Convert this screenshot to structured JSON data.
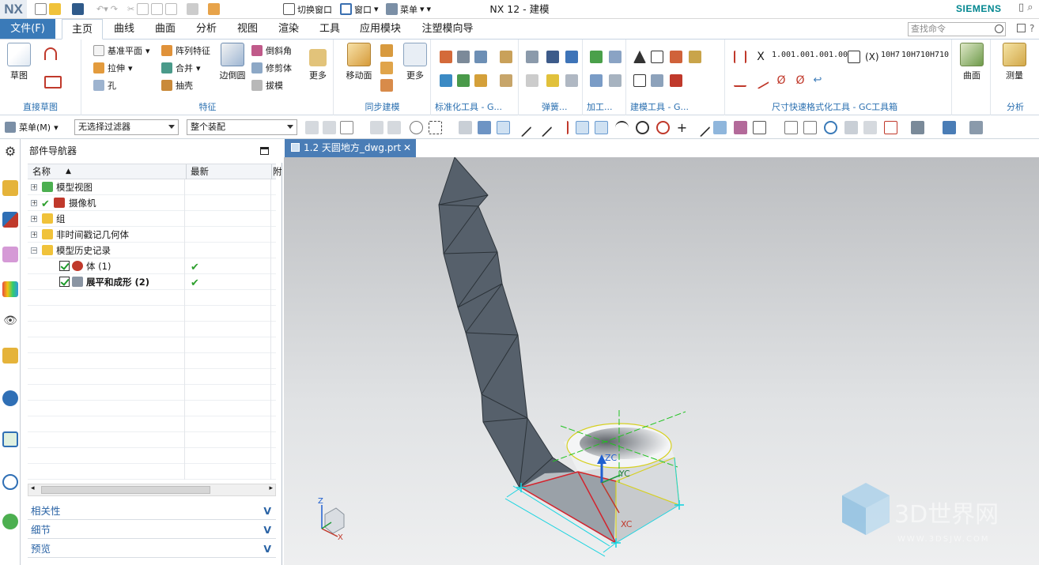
{
  "window": {
    "title": "NX 12 - 建模",
    "logo": "NX",
    "brand": "SIEMENS",
    "quick_access": {
      "switch_window": "切换窗口",
      "window_menu": "窗口",
      "menu": "菜单"
    }
  },
  "tabs": {
    "file": "文件(F)",
    "items": [
      "主页",
      "曲线",
      "曲面",
      "分析",
      "视图",
      "渲染",
      "工具",
      "应用模块",
      "注塑模向导"
    ],
    "search_placeholder": "查找命令"
  },
  "ribbon": {
    "direct_sketch": {
      "label": "直接草图",
      "sketch": "草图"
    },
    "feature": {
      "label": "特征",
      "datum_plane": "基准平面",
      "extrude": "拉伸",
      "hole": "孔",
      "pattern_feature": "阵列特征",
      "unite": "合并",
      "shell": "抽壳",
      "edge_blend": "边倒圆",
      "chamfer": "倒斜角",
      "trim_body": "修剪体",
      "draft": "拔模",
      "more": "更多"
    },
    "sync_modeling": {
      "label": "同步建模",
      "move_face": "移动面",
      "more": "更多"
    },
    "group_labels": [
      "标准化工具 - G...",
      "弹簧...",
      "加工...",
      "建模工具 - G...",
      "尺寸快速格式化工具 - GC工具箱"
    ],
    "surface": {
      "label": "曲面"
    },
    "analysis": {
      "label": "分析",
      "measure": "测量"
    },
    "dim_texts": [
      "1.00",
      "1.00",
      "1.00",
      "1.00",
      "10H7",
      "10H7",
      "10H7",
      "10"
    ]
  },
  "toolbar2": {
    "menu": "菜单(M)",
    "filter": "无选择过滤器",
    "assembly": "整个装配"
  },
  "navigator": {
    "title": "部件导航器",
    "columns": {
      "name": "名称",
      "latest": "最新",
      "extra": "附"
    },
    "rows": [
      {
        "label": "模型视图"
      },
      {
        "label": "摄像机"
      },
      {
        "label": "组"
      },
      {
        "label": "非时间戳记几何体"
      },
      {
        "label": "模型历史记录"
      },
      {
        "label": "体 (1)"
      },
      {
        "label": "展平和成形 (2)"
      }
    ],
    "panels": [
      "相关性",
      "细节",
      "预览"
    ]
  },
  "viewport": {
    "tab_title": "1.2 天圆地方_dwg.prt",
    "triad_labels": {
      "z": "ZC",
      "y": "YC",
      "x": "XC"
    },
    "mini_axes": {
      "z": "Z",
      "x": "X"
    },
    "watermark": "3D世界网",
    "watermark_url": "WWW.3DSJW.COM"
  },
  "colors": {
    "accent": "#3a7ab8",
    "group_label": "#2a6fb0",
    "sheet_fill": "#56606b",
    "ok_green": "#2ea02e"
  }
}
